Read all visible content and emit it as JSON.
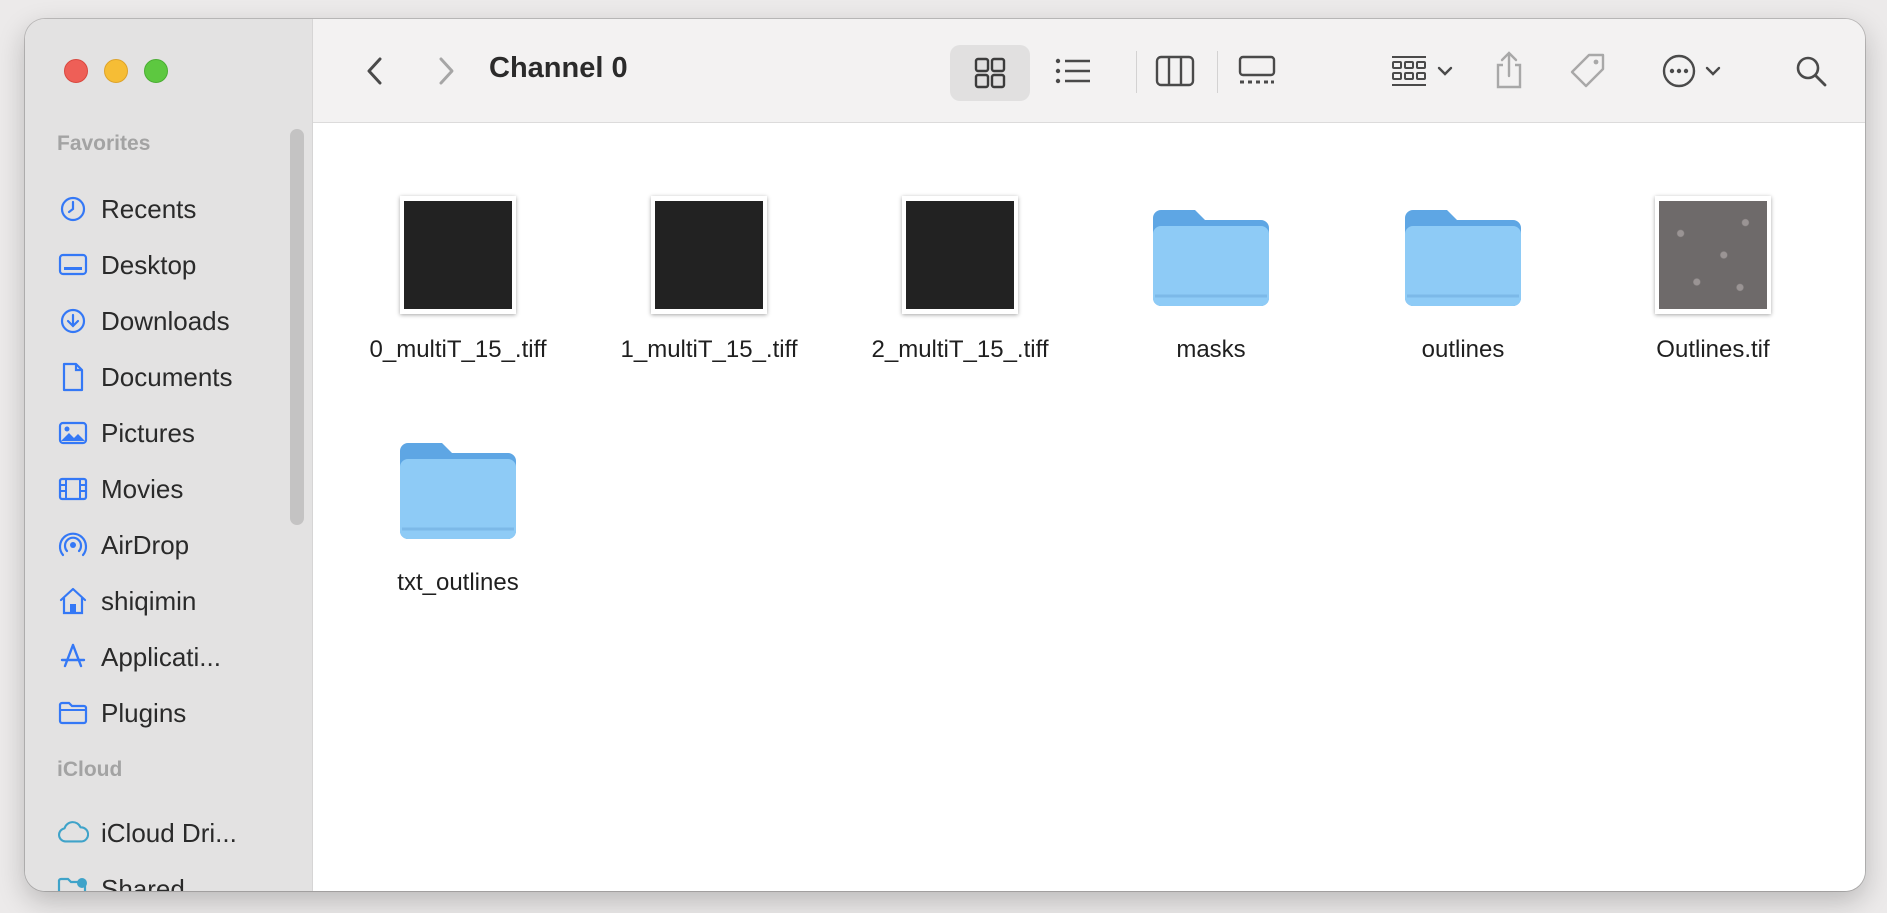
{
  "window": {
    "title": "Channel 0"
  },
  "sidebar": {
    "favorites_label": "Favorites",
    "favorites": [
      {
        "label": "Recents",
        "icon": "clock-icon"
      },
      {
        "label": "Desktop",
        "icon": "desktop-icon"
      },
      {
        "label": "Downloads",
        "icon": "download-icon"
      },
      {
        "label": "Documents",
        "icon": "document-icon"
      },
      {
        "label": "Pictures",
        "icon": "photo-icon"
      },
      {
        "label": "Movies",
        "icon": "film-icon"
      },
      {
        "label": "AirDrop",
        "icon": "airdrop-icon"
      },
      {
        "label": "shiqimin",
        "icon": "home-icon"
      },
      {
        "label": "Applicati...",
        "icon": "applications-icon"
      },
      {
        "label": "Plugins",
        "icon": "folder-icon"
      }
    ],
    "icloud_label": "iCloud",
    "icloud": [
      {
        "label": "iCloud Dri...",
        "icon": "cloud-icon"
      },
      {
        "label": "Shared",
        "icon": "shared-folder-icon"
      }
    ]
  },
  "files": [
    {
      "name": "0_multiT_15_.tiff",
      "kind": "image-dark"
    },
    {
      "name": "1_multiT_15_.tiff",
      "kind": "image-dark"
    },
    {
      "name": "2_multiT_15_.tiff",
      "kind": "image-dark"
    },
    {
      "name": "masks",
      "kind": "folder"
    },
    {
      "name": "outlines",
      "kind": "folder"
    },
    {
      "name": "Outlines.tif",
      "kind": "image-gray"
    },
    {
      "name": "txt_outlines",
      "kind": "folder"
    }
  ],
  "colors": {
    "accent": "#3478f6",
    "folder": "#8ecbf6",
    "folder_tab": "#5ea6e4"
  }
}
